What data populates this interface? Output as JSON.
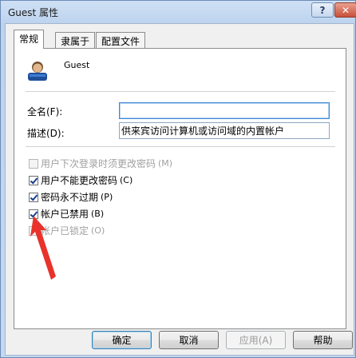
{
  "window": {
    "title": "Guest 属性",
    "help_glyph": "?",
    "close_glyph": "✕"
  },
  "tabs": [
    {
      "label": "常规",
      "active": true
    },
    {
      "label": "隶属于",
      "active": false
    },
    {
      "label": "配置文件",
      "active": false
    }
  ],
  "user": {
    "name": "Guest"
  },
  "fields": {
    "fullname_label": "全名(F):",
    "fullname_value": "",
    "description_label": "描述(D):",
    "description_value": "供来宾访问计算机或访问域的内置帐户"
  },
  "checkboxes": [
    {
      "label": "用户下次登录时须更改密码",
      "hotkey": "(M)",
      "checked": false,
      "disabled": true
    },
    {
      "label": "用户不能更改密码",
      "hotkey": "(C)",
      "checked": true,
      "disabled": false
    },
    {
      "label": "密码永不过期",
      "hotkey": "(P)",
      "checked": true,
      "disabled": false
    },
    {
      "label": "帐户已禁用",
      "hotkey": "(B)",
      "checked": true,
      "disabled": false
    },
    {
      "label": "帐户已锁定",
      "hotkey": "(O)",
      "checked": false,
      "disabled": true
    }
  ],
  "buttons": {
    "ok": "确定",
    "cancel": "取消",
    "apply": "应用(A)",
    "help": "帮助"
  },
  "colors": {
    "annotation_arrow": "#e8322b"
  }
}
